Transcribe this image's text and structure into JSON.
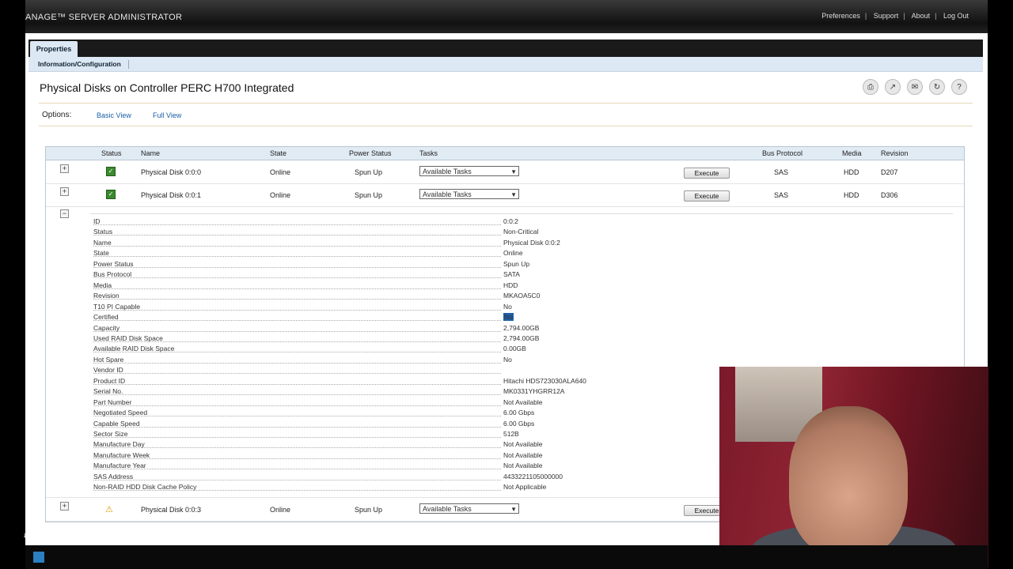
{
  "header": {
    "brand": "ANAGE™ SERVER ADMINISTRATOR",
    "links": [
      "Preferences",
      "Support",
      "About",
      "Log Out"
    ]
  },
  "tabs": {
    "active": "Properties",
    "sub": "Information/Configuration"
  },
  "page": {
    "title": "Physical Disks on Controller PERC H700 Integrated"
  },
  "options": {
    "label": "Options:",
    "basic": "Basic View",
    "full": "Full View"
  },
  "table": {
    "headers": [
      "Status",
      "Name",
      "State",
      "Power Status",
      "Tasks",
      "Bus Protocol",
      "Media",
      "Revision"
    ],
    "tasks_label": "Available Tasks",
    "execute_label": "Execute",
    "rows": [
      {
        "name": "Physical Disk 0:0:0",
        "state": "Online",
        "power": "Spun Up",
        "bus": "SAS",
        "media": "HDD",
        "revision": "D207"
      },
      {
        "name": "Physical Disk 0:0:1",
        "state": "Online",
        "power": "Spun Up",
        "bus": "SAS",
        "media": "HDD",
        "revision": "D306"
      },
      {
        "name": "Physical Disk 0:0:3",
        "state": "Online",
        "power": "Spun Up"
      }
    ],
    "detail": [
      {
        "k": "ID",
        "v": "0:0:2"
      },
      {
        "k": "Status",
        "v": "Non-Critical"
      },
      {
        "k": "Name",
        "v": "Physical Disk 0:0:2"
      },
      {
        "k": "State",
        "v": "Online"
      },
      {
        "k": "Power Status",
        "v": "Spun Up"
      },
      {
        "k": "Bus Protocol",
        "v": "SATA"
      },
      {
        "k": "Media",
        "v": "HDD"
      },
      {
        "k": "Revision",
        "v": "MKAOA5C0"
      },
      {
        "k": "T10 PI Capable",
        "v": "No"
      },
      {
        "k": "Certified",
        "v": "No"
      },
      {
        "k": "Capacity",
        "v": "2,794.00GB"
      },
      {
        "k": "Used RAID Disk Space",
        "v": "2,794.00GB"
      },
      {
        "k": "Available RAID Disk Space",
        "v": "0.00GB"
      },
      {
        "k": "Hot Spare",
        "v": "No"
      },
      {
        "k": "Vendor ID",
        "v": ""
      },
      {
        "k": "Product ID",
        "v": "Hitachi HDS723030ALA640"
      },
      {
        "k": "Serial No.",
        "v": "MK0331YHGRR12A"
      },
      {
        "k": "Part Number",
        "v": "Not Available"
      },
      {
        "k": "Negotiated Speed",
        "v": "6.00 Gbps"
      },
      {
        "k": "Capable Speed",
        "v": "6.00 Gbps"
      },
      {
        "k": "Sector Size",
        "v": "512B"
      },
      {
        "k": "Manufacture Day",
        "v": "Not Available"
      },
      {
        "k": "Manufacture Week",
        "v": "Not Available"
      },
      {
        "k": "Manufacture Year",
        "v": "Not Available"
      },
      {
        "k": "SAS Address",
        "v": "4433221105000000"
      },
      {
        "k": "Non-RAID HDD Disk Cache Policy",
        "v": "Not Applicable"
      }
    ]
  },
  "colors": {
    "accent": "#1b5fa7",
    "ok": "#3b8a2e",
    "warning": "#d8a000"
  }
}
